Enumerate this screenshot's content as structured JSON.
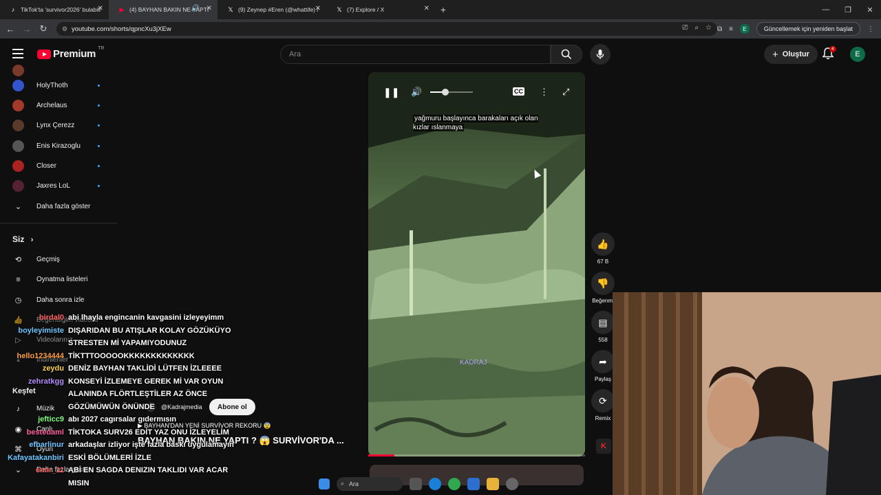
{
  "browser": {
    "tabs": [
      {
        "label": "TikTok'ta 'survivor2026' bulabili",
        "icon": "tiktok-icon",
        "color": "#ffffff"
      },
      {
        "label": "(4) BAYHAN BAKIN NE YAPTI",
        "icon": "youtube-icon",
        "color": "#ff0033"
      },
      {
        "label": "(9) Zeynep #Eren (@whattife) /",
        "icon": "x-icon",
        "color": "#ffffff"
      },
      {
        "label": "(7) Explore / X",
        "icon": "x-icon",
        "color": "#ffffff"
      }
    ],
    "url": "youtube.com/shorts/qpncXu3jXEw",
    "update_label": "Güncellemek için yeniden başlat",
    "profile_letter": "E"
  },
  "yt": {
    "brand": "Premium",
    "country": "TR",
    "search_placeholder": "Ara",
    "create_label": "Oluştur",
    "notif_count": "4",
    "avatar_letter": "E"
  },
  "sidebar": {
    "subscriptions": [
      {
        "label": "HolyThoth",
        "color": "#3355cc"
      },
      {
        "label": "Archelaus",
        "color": "#a33a2a"
      },
      {
        "label": "Lynx Çerezz",
        "color": "#5a3a2a"
      },
      {
        "label": "Enis Kirazoglu",
        "color": "#555555"
      },
      {
        "label": "Closer",
        "color": "#aa2222"
      },
      {
        "label": "Jaxres LoL",
        "color": "#552233"
      }
    ],
    "show_more": "Daha fazla göster",
    "you_heading": "Siz",
    "you_items": [
      "Geçmiş",
      "Oynatma listeleri",
      "Daha sonra izle",
      "Beğendiğim videolar",
      "Videolarınız",
      "İndirilenler"
    ],
    "explore_heading": "Keşfet",
    "explore_items": [
      "Müzik",
      "Canlı",
      "Oyun"
    ],
    "explore_more": "Daha fazla göster"
  },
  "short": {
    "caption": "yağmuru başlayınca barakaları açık olan kızlar ıslanmaya",
    "watermark": "KADRAJ",
    "channel": "@Kadrajmedia",
    "subscribe": "Abone ol",
    "subtitle": "BAYHAN'DAN YENİ SURVİVOR REKORU 😨",
    "title": "BAYHAN BAKIN NE YAPTI ? 😱 SURVİVOR'DA ...",
    "progress": 0.12,
    "volume": 0.35
  },
  "actions": {
    "like_count": "67 B",
    "dislike_label": "Beğenmi",
    "comment_count": "558",
    "share_label": "Paylaş",
    "remix_label": "Remix"
  },
  "chat": [
    {
      "user": "birdal0",
      "user_color": "#ff6060",
      "text": "abi lhayla engincanin kavgasini izleyeyimm"
    },
    {
      "user": "boyleyimiste",
      "user_color": "#6ec6ff",
      "text": "DIŞARIDAN BU ATIŞLAR KOLAY GÖZÜKÜYO"
    },
    {
      "user": "",
      "user_color": "#ffffff",
      "text": "STRESTEN Mİ YAPAMIYODUNUZ"
    },
    {
      "user": "hello1234444",
      "user_color": "#ff9f40",
      "text": "TİKTTTOOOOOKKKKKKKKKKKKK"
    },
    {
      "user": "zeydu",
      "user_color": "#ffd24d",
      "text": "DENİZ BAYHAN TAKLİDİ LÜTFEN İZLEEEE"
    },
    {
      "user": "zehratkgg",
      "user_color": "#b58cff",
      "text": "KONSEYİ İZLEMEYE GEREK Mİ VAR OYUN"
    },
    {
      "user": "",
      "user_color": "#ffffff",
      "text": "ALANINDA FLÖRTLEŞTİLER AZ ÖNCE"
    },
    {
      "user": "",
      "user_color": "#ffffff",
      "text": "GÖZÜMÜWÜN ÖNÜNDE"
    },
    {
      "user": "jefticc9",
      "user_color": "#7cff7c",
      "text": "abı 2027 cagırsalar gıdermısın"
    },
    {
      "user": "bestedaml",
      "user_color": "#ff5f9e",
      "text": "TİKTOKA SURV26 EDİT YAZ ONU İZLEYELİM"
    },
    {
      "user": "efbarlinur",
      "user_color": "#6ec6ff",
      "text": "arkadaşlar izliyor işte fazla baskı uygulamayın"
    },
    {
      "user": "Kafayatakanbiri",
      "user_color": "#6ec6ff",
      "text": "ESKİ BÖLÜMLERİ İZLE"
    },
    {
      "user": "emir_11",
      "user_color": "#ff6060",
      "text": "ABİ EN SAGDA DENIZIN TAKLIDI VAR ACAR"
    },
    {
      "user": "",
      "user_color": "#ffffff",
      "text": "MISIN"
    }
  ],
  "taskbar": {
    "search_label": "Ara"
  }
}
